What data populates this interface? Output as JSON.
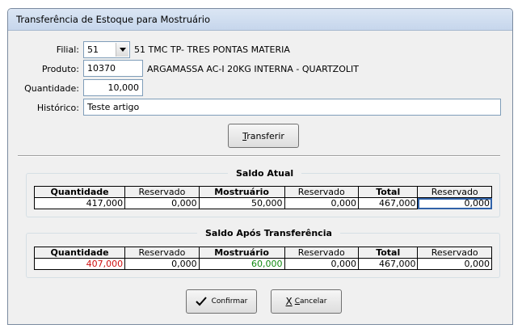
{
  "window": {
    "title": "Transferência de Estoque para Mostruário"
  },
  "form": {
    "filial_label": "Filial:",
    "filial_value": "51",
    "filial_desc": "51 TMC TP- TRES PONTAS MATERIA",
    "produto_label": "Produto:",
    "produto_value": "10370",
    "produto_desc": "ARGAMASSA AC-I 20KG INTERNA - QUARTZOLIT",
    "quantidade_label": "Quantidade:",
    "quantidade_value": "10,000",
    "historico_label": "Histórico:",
    "historico_value": "Teste artigo"
  },
  "buttons": {
    "transferir_prefix": "T",
    "transferir_rest": "ransferir",
    "confirmar": "Confirmar",
    "cancelar_prefix": "C",
    "cancelar_rest": "ancelar"
  },
  "saldo_atual": {
    "title": "Saldo Atual",
    "headers": [
      "Quantidade",
      "Reservado",
      "Mostruário",
      "Reservado",
      "Total",
      "Reservado"
    ],
    "values": [
      "417,000",
      "0,000",
      "50,000",
      "0,000",
      "467,000",
      "0,000"
    ]
  },
  "saldo_apos": {
    "title": "Saldo Após Transferência",
    "headers": [
      "Quantidade",
      "Reservado",
      "Mostruário",
      "Reservado",
      "Total",
      "Reservado"
    ],
    "values": [
      "407,000",
      "0,000",
      "60,000",
      "0,000",
      "467,000",
      "0,000"
    ]
  },
  "colors": {
    "decrease": "#d01010",
    "increase": "#118a11",
    "selection": "#3062a8"
  },
  "icons": {
    "confirm": "checkmark-icon",
    "cancel": "x-icon",
    "dropdown": "chevron-down-icon"
  }
}
